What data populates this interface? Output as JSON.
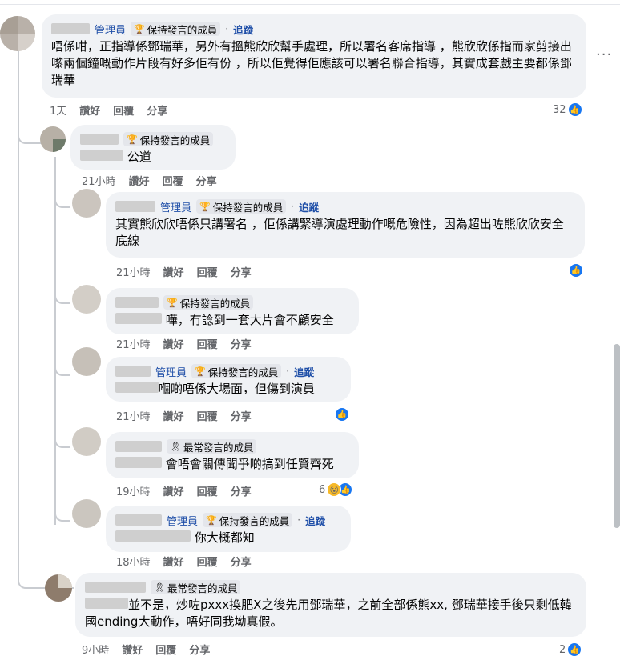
{
  "colors": {
    "bubble": "#f0f2f5",
    "link": "#1f4fa8",
    "meta": "#65676b",
    "like": "#1877f2"
  },
  "comments": [
    {
      "role": "管理員",
      "badge": "保持發言的成員",
      "follow": "追蹤",
      "text": "唔係咁，正指導係鄧瑞華，另外有搵熊欣欣幫手處理，所以署名客席指導 ，熊欣欣係指而家剪接出嚟兩個鐘嘅動作片段有好多佢有份 ，所以佢覺得佢應該可以署名聯合指導，其實成套戲主要都係鄧瑞華",
      "time": "1天",
      "like": "讚好",
      "reply": "回覆",
      "share": "分享",
      "reactions": "32"
    },
    {
      "badge": "保持發言的成員",
      "text": "公道",
      "time": "21小時",
      "like": "讚好",
      "reply": "回覆",
      "share": "分享"
    },
    {
      "role": "管理員",
      "badge": "保持發言的成員",
      "follow": "追蹤",
      "text": "其實熊欣欣唔係只講署名 ，佢係講緊導演處理動作嘅危險性，因為超出咗熊欣欣安全底線",
      "time": "21小時",
      "like": "讚好",
      "reply": "回覆",
      "share": "分享"
    },
    {
      "badge": "保持發言的成員",
      "text": "嘩，冇諗到一套大片會不顧安全",
      "time": "21小時",
      "like": "讚好",
      "reply": "回覆",
      "share": "分享"
    },
    {
      "role": "管理員",
      "badge": "保持發言的成員",
      "follow": "追蹤",
      "text": "嗰啲唔係大場面，但傷到演員",
      "time": "21小時",
      "like": "讚好",
      "reply": "回覆",
      "share": "分享"
    },
    {
      "badge": "最常發言的成員",
      "text": "會唔會關傳聞爭啲搞到任賢齊死",
      "time": "19小時",
      "like": "讚好",
      "reply": "回覆",
      "share": "分享",
      "reactions": "6"
    },
    {
      "role": "管理員",
      "badge": "保持發言的成員",
      "follow": "追蹤",
      "text": "你大概都知",
      "time": "18小時",
      "like": "讚好",
      "reply": "回覆",
      "share": "分享"
    },
    {
      "badge": "最常發言的成員",
      "text": "並不是，炒咗pxxx換肥X之後先用鄧瑞華，之前全部係熊xx, 鄧瑞華接手後只剩低韓國ending大動作，唔好同我坳真假。",
      "time": "9小時",
      "like": "讚好",
      "reply": "回覆",
      "share": "分享",
      "reactions": "2"
    }
  ],
  "icons": {
    "trophy": "trophy-icon",
    "ribbon": "ribbon-icon",
    "like": "like-icon",
    "wow": "wow-icon",
    "more": "more-options-icon"
  }
}
